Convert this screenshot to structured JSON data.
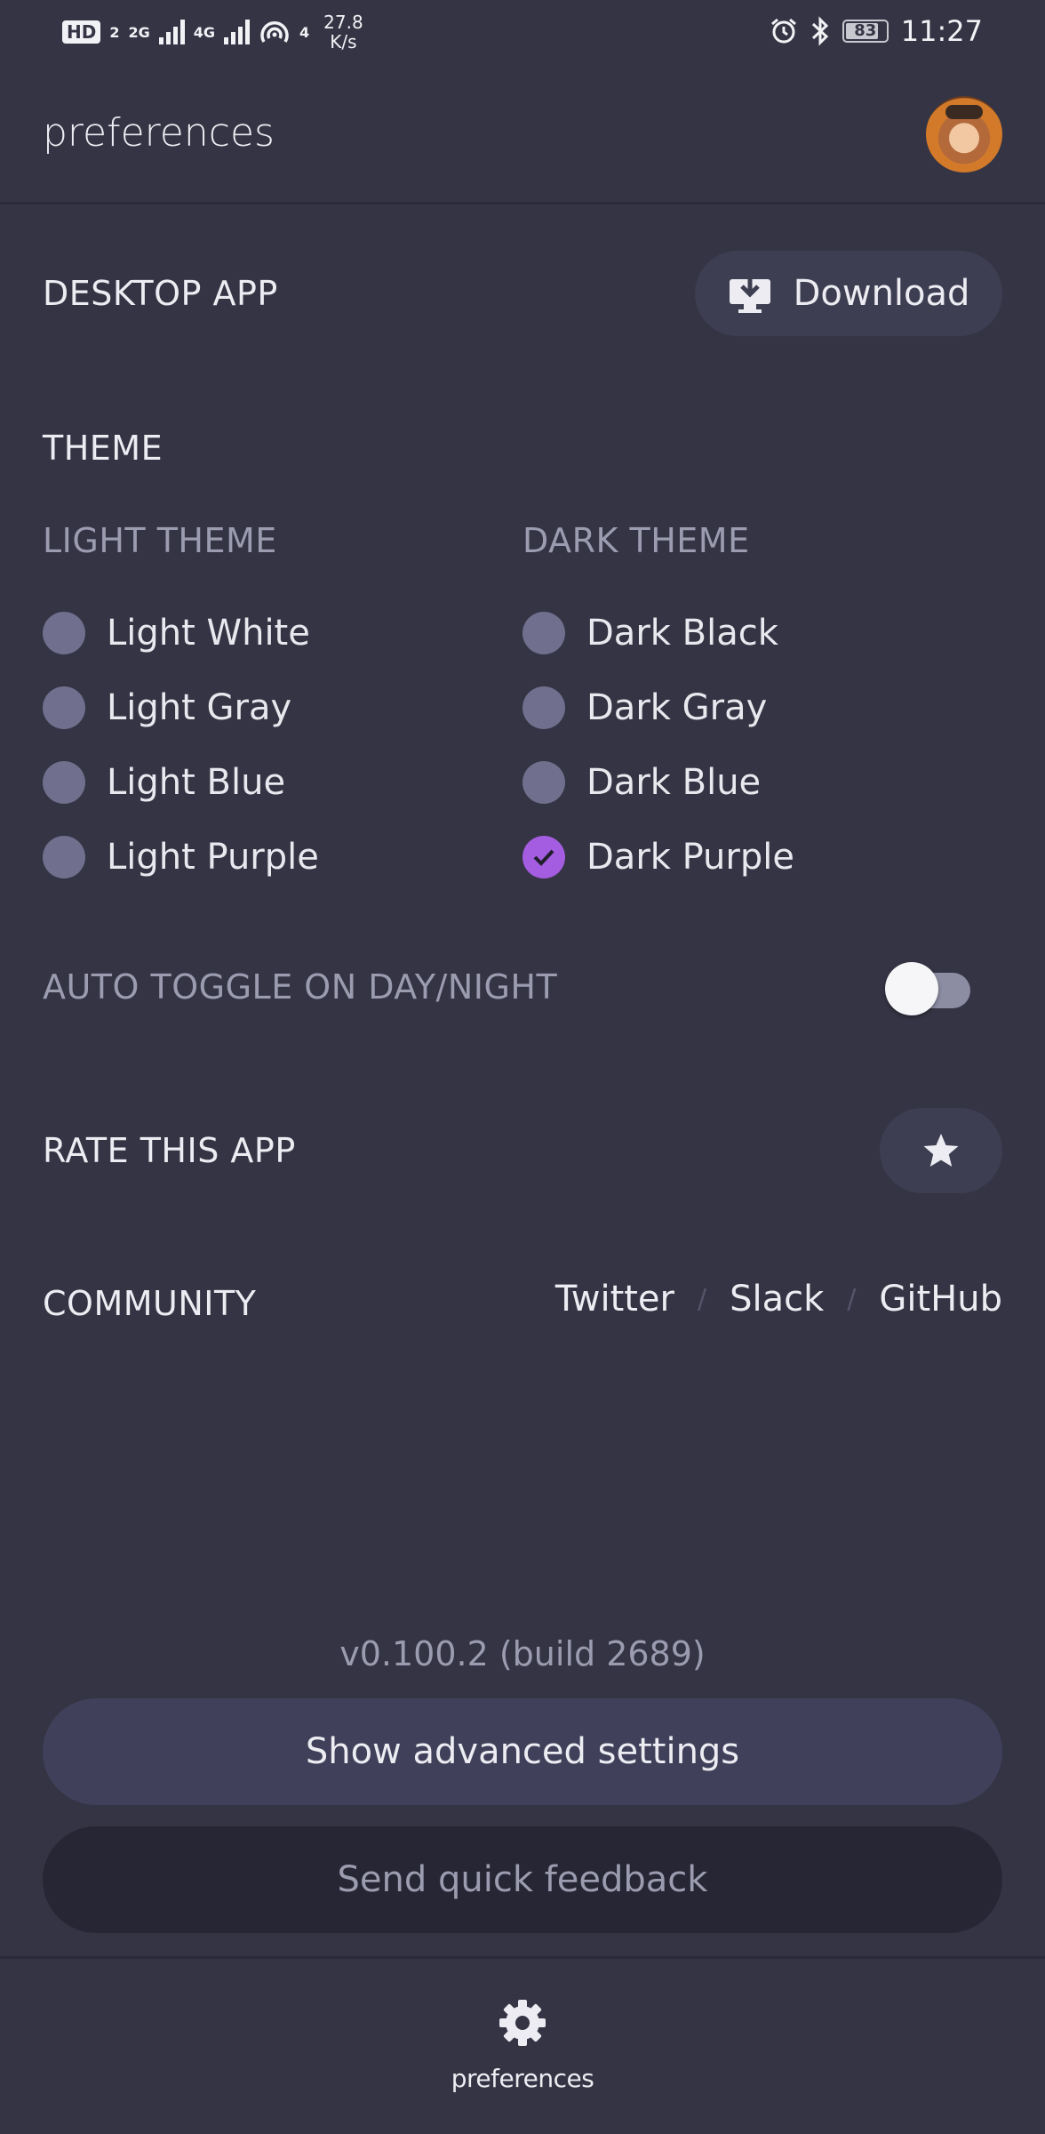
{
  "status_bar": {
    "network_badge": "HD",
    "network_badge_sub": "2",
    "sim1": "2G",
    "sim2": "4G",
    "hotspot_count": "4",
    "speed_value": "27.8",
    "speed_unit": "K/s",
    "battery": "83",
    "time": "11:27"
  },
  "header": {
    "title": "preferences"
  },
  "desktop_app": {
    "label": "DESKTOP APP",
    "download_label": "Download"
  },
  "theme": {
    "label": "THEME",
    "light_header": "LIGHT THEME",
    "dark_header": "DARK THEME",
    "light_options": [
      "Light White",
      "Light Gray",
      "Light Blue",
      "Light Purple"
    ],
    "dark_options": [
      "Dark Black",
      "Dark Gray",
      "Dark Blue",
      "Dark Purple"
    ],
    "selected": "Dark Purple"
  },
  "auto_toggle": {
    "label": "AUTO TOGGLE ON DAY/NIGHT",
    "enabled": false
  },
  "rate": {
    "label": "RATE THIS APP"
  },
  "community": {
    "label": "COMMUNITY",
    "links": [
      "Twitter",
      "Slack",
      "GitHub"
    ],
    "separator": "/"
  },
  "footer": {
    "version": "v0.100.2 (build 2689)",
    "advanced_label": "Show advanced settings",
    "feedback_label": "Send quick feedback"
  },
  "bottom_nav": {
    "preferences_label": "preferences"
  },
  "colors": {
    "background": "#343444",
    "accent": "#a45de0",
    "radio_unselected": "#70708e"
  }
}
